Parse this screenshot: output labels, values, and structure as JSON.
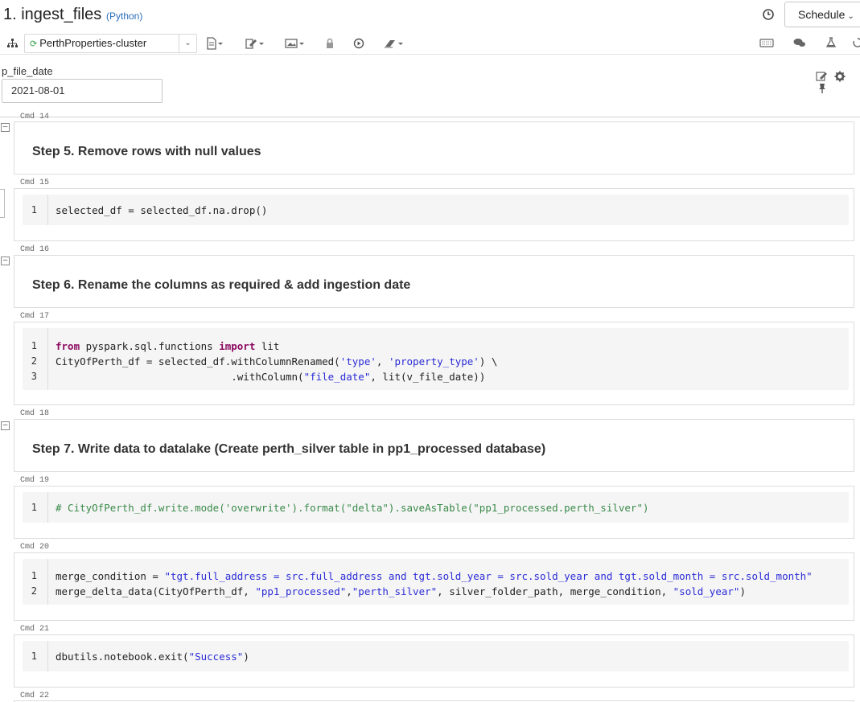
{
  "header": {
    "title": "1. ingest_files",
    "language": "(Python)",
    "schedule_label": "Schedule"
  },
  "toolbar": {
    "cluster_name": "PerthProperties-cluster"
  },
  "widget": {
    "label": "p_file_date",
    "value": "2021-08-01"
  },
  "cells": {
    "cmd14": {
      "cmd": "Cmd 14",
      "heading": "Step 5. Remove rows with null values"
    },
    "cmd15": {
      "cmd": "Cmd 15",
      "lines": [
        "selected_df = selected_df.na.drop()"
      ]
    },
    "cmd16": {
      "cmd": "Cmd 16",
      "heading": "Step 6. Rename the columns as required & add ingestion date"
    },
    "cmd17": {
      "cmd": "Cmd 17",
      "l1_kw1": "from",
      "l1_mid": " pyspark.sql.functions ",
      "l1_kw2": "import",
      "l1_end": " lit",
      "l2_a": "CityOfPerth_df = selected_df.withColumnRenamed(",
      "l2_s1": "'type'",
      "l2_b": ", ",
      "l2_s2": "'property_type'",
      "l2_c": ") \\",
      "l3_a": "                             .withColumn(",
      "l3_s1": "\"file_date\"",
      "l3_b": ", lit(v_file_date))"
    },
    "cmd18": {
      "cmd": "Cmd 18",
      "heading": "Step 7. Write data to datalake (Create perth_silver table in pp1_processed database)"
    },
    "cmd19": {
      "cmd": "Cmd 19",
      "comment": "# CityOfPerth_df.write.mode('overwrite').format(\"delta\").saveAsTable(\"pp1_processed.perth_silver\")"
    },
    "cmd20": {
      "cmd": "Cmd 20",
      "l1_a": "merge_condition = ",
      "l1_s": "\"tgt.full_address = src.full_address and tgt.sold_year = src.sold_year and tgt.sold_month = src.sold_month\"",
      "l2_a": "merge_delta_data(CityOfPerth_df, ",
      "l2_s1": "\"pp1_processed\"",
      "l2_b": ",",
      "l2_s2": "\"perth_silver\"",
      "l2_c": ", silver_folder_path, merge_condition, ",
      "l2_s3": "\"sold_year\"",
      "l2_d": ")"
    },
    "cmd21": {
      "cmd": "Cmd 21",
      "l1_a": "dbutils.notebook.exit(",
      "l1_s": "\"Success\"",
      "l1_b": ")"
    },
    "cmd22": {
      "cmd": "Cmd 22"
    }
  },
  "line_numbers": [
    "1",
    "2",
    "3"
  ]
}
